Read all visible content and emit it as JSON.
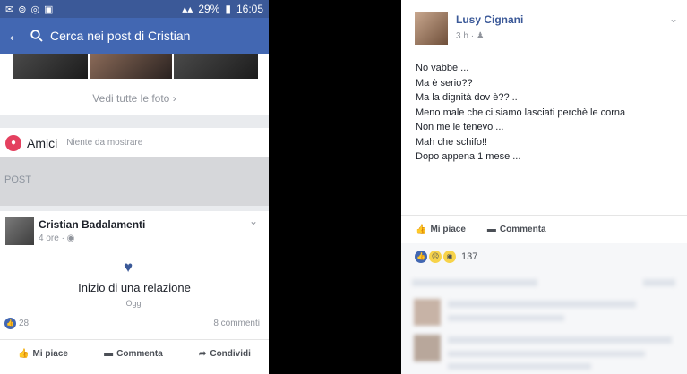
{
  "left": {
    "status": {
      "left_icons": [
        "✉",
        "⊚",
        "◎",
        "▣"
      ],
      "battery": "29%",
      "time": "16:05"
    },
    "search_placeholder": "Cerca nei post di Cristian",
    "see_all_photos": "Vedi tutte le foto",
    "friends": {
      "title": "Amici",
      "subtitle": "Niente da mostrare"
    },
    "section_label": "POST",
    "post": {
      "author": "Cristian Badalamenti",
      "time": "4 ore",
      "event": "Inizio di una relazione",
      "event_date": "Oggi",
      "likes_count": "28",
      "comments_count": "8 commenti",
      "actions": [
        "Mi piace",
        "Commenta",
        "Condividi"
      ]
    }
  },
  "right": {
    "author": "Lusy Cignani",
    "time": "3 h",
    "lines": [
      "No vabbe ...",
      "Ma è serio??",
      "Ma la dignità dov è?? ..",
      "Meno male che ci siamo lasciati perchè le corna",
      "Non me le tenevo ...",
      "Mah che schifo!!",
      "Dopo appena 1 mese ..."
    ],
    "actions": [
      "Mi piace",
      "Commenta"
    ],
    "reactions_count": "137"
  },
  "colors": {
    "facebook_blue": "#4267b2",
    "status_bar": "#3b5998"
  },
  "icons": [
    "back-arrow-icon",
    "search-icon",
    "friends-icon",
    "heart-icon",
    "like-icon",
    "comment-icon",
    "share-icon",
    "globe-icon",
    "chevron-down-icon",
    "sad-emoji-icon",
    "wow-emoji-icon"
  ]
}
